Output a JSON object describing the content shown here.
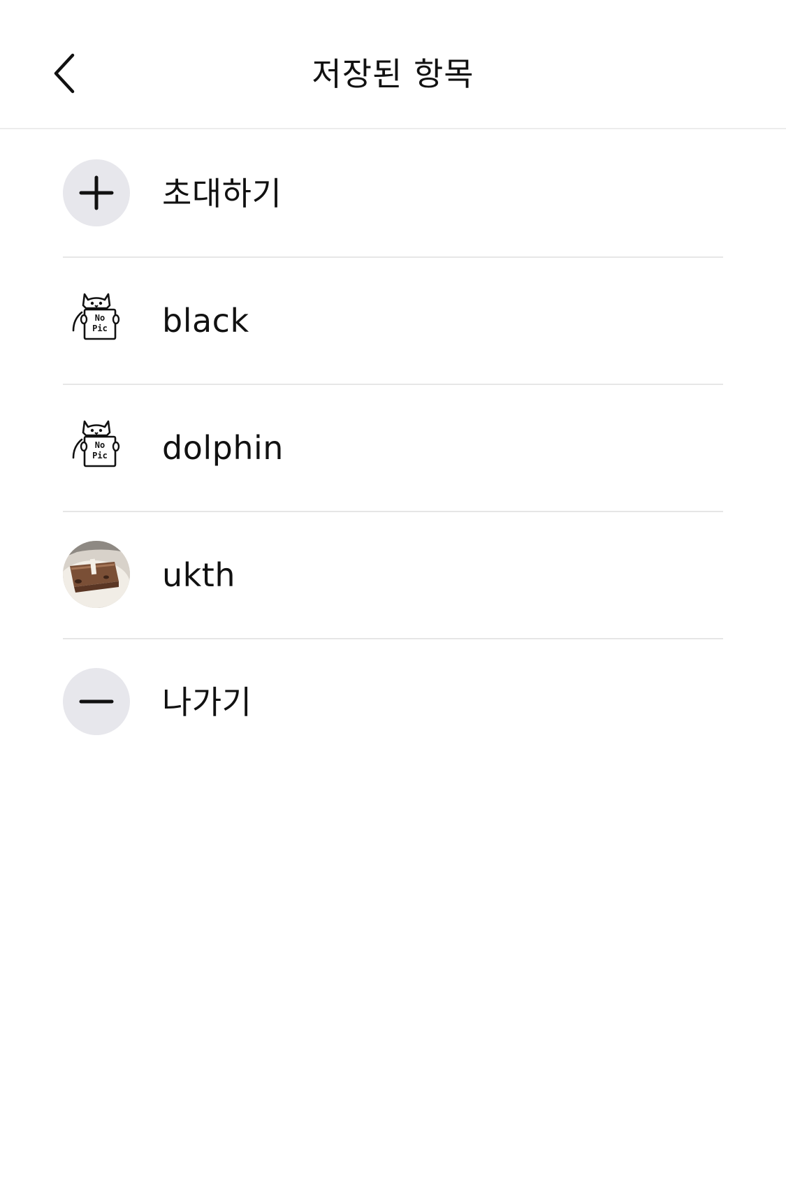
{
  "header": {
    "title": "저장된 항목",
    "back_icon": "chevron-left-icon"
  },
  "rows": [
    {
      "label": "초대하기",
      "icon": "plus-icon",
      "kind": "action"
    },
    {
      "label": "black",
      "icon": "no-pic-cat-icon",
      "avatar_text": [
        "No",
        "Pic"
      ]
    },
    {
      "label": "dolphin",
      "icon": "no-pic-cat-icon",
      "avatar_text": [
        "No",
        "Pic"
      ]
    },
    {
      "label": "ukth",
      "icon": "profile-photo",
      "kind": "photo"
    },
    {
      "label": "나가기",
      "icon": "minus-icon",
      "kind": "action"
    }
  ],
  "colors": {
    "action_circle": "#e7e7ec",
    "divider": "#e6e6e6",
    "text": "#111111"
  }
}
